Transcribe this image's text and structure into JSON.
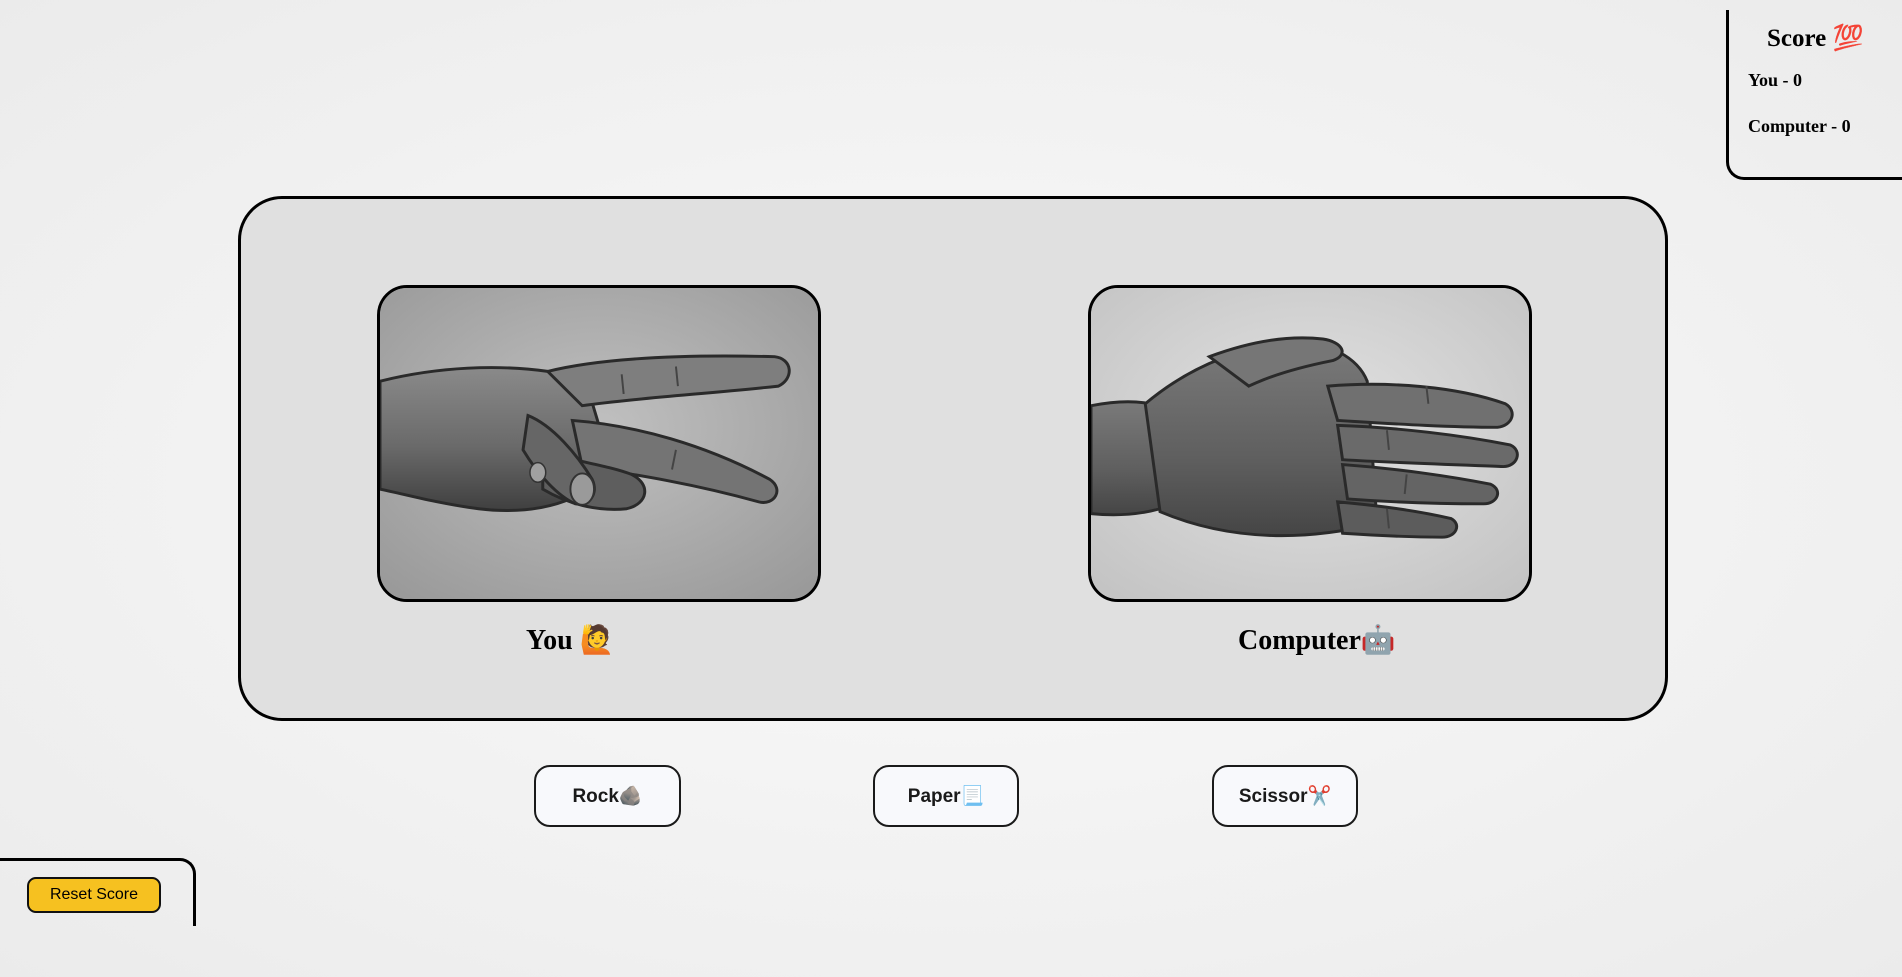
{
  "score": {
    "title": "Score 💯",
    "you": "You - 0",
    "computer": "Computer - 0"
  },
  "arena": {
    "you_label": "You 🙋",
    "computer_label": "Computer🤖",
    "you_hand_icon": "scissors-hand-icon",
    "computer_hand_icon": "paper-hand-icon"
  },
  "choices": {
    "rock": "Rock🪨",
    "paper": "Paper📃",
    "scissor": "Scissor✂️"
  },
  "reset": {
    "label": "Reset Score",
    "color": "#f6c120"
  }
}
